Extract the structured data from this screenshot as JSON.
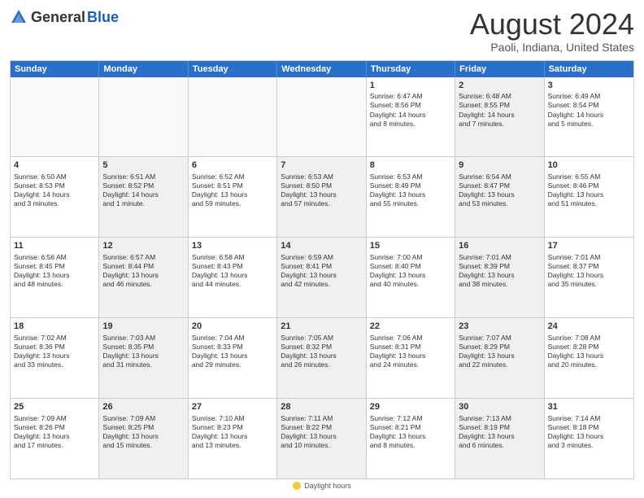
{
  "logo": {
    "general": "General",
    "blue": "Blue"
  },
  "title": "August 2024",
  "location": "Paoli, Indiana, United States",
  "days_of_week": [
    "Sunday",
    "Monday",
    "Tuesday",
    "Wednesday",
    "Thursday",
    "Friday",
    "Saturday"
  ],
  "footer": "Daylight hours",
  "weeks": [
    [
      {
        "day": "",
        "text": "",
        "shaded": false,
        "empty": true
      },
      {
        "day": "",
        "text": "",
        "shaded": false,
        "empty": true
      },
      {
        "day": "",
        "text": "",
        "shaded": false,
        "empty": true
      },
      {
        "day": "",
        "text": "",
        "shaded": false,
        "empty": true
      },
      {
        "day": "1",
        "text": "Sunrise: 6:47 AM\nSunset: 8:56 PM\nDaylight: 14 hours\nand 8 minutes.",
        "shaded": false,
        "empty": false
      },
      {
        "day": "2",
        "text": "Sunrise: 6:48 AM\nSunset: 8:55 PM\nDaylight: 14 hours\nand 7 minutes.",
        "shaded": true,
        "empty": false
      },
      {
        "day": "3",
        "text": "Sunrise: 6:49 AM\nSunset: 8:54 PM\nDaylight: 14 hours\nand 5 minutes.",
        "shaded": false,
        "empty": false
      }
    ],
    [
      {
        "day": "4",
        "text": "Sunrise: 6:50 AM\nSunset: 8:53 PM\nDaylight: 14 hours\nand 3 minutes.",
        "shaded": false,
        "empty": false
      },
      {
        "day": "5",
        "text": "Sunrise: 6:51 AM\nSunset: 8:52 PM\nDaylight: 14 hours\nand 1 minute.",
        "shaded": true,
        "empty": false
      },
      {
        "day": "6",
        "text": "Sunrise: 6:52 AM\nSunset: 8:51 PM\nDaylight: 13 hours\nand 59 minutes.",
        "shaded": false,
        "empty": false
      },
      {
        "day": "7",
        "text": "Sunrise: 6:53 AM\nSunset: 8:50 PM\nDaylight: 13 hours\nand 57 minutes.",
        "shaded": true,
        "empty": false
      },
      {
        "day": "8",
        "text": "Sunrise: 6:53 AM\nSunset: 8:49 PM\nDaylight: 13 hours\nand 55 minutes.",
        "shaded": false,
        "empty": false
      },
      {
        "day": "9",
        "text": "Sunrise: 6:54 AM\nSunset: 8:47 PM\nDaylight: 13 hours\nand 53 minutes.",
        "shaded": true,
        "empty": false
      },
      {
        "day": "10",
        "text": "Sunrise: 6:55 AM\nSunset: 8:46 PM\nDaylight: 13 hours\nand 51 minutes.",
        "shaded": false,
        "empty": false
      }
    ],
    [
      {
        "day": "11",
        "text": "Sunrise: 6:56 AM\nSunset: 8:45 PM\nDaylight: 13 hours\nand 48 minutes.",
        "shaded": false,
        "empty": false
      },
      {
        "day": "12",
        "text": "Sunrise: 6:57 AM\nSunset: 8:44 PM\nDaylight: 13 hours\nand 46 minutes.",
        "shaded": true,
        "empty": false
      },
      {
        "day": "13",
        "text": "Sunrise: 6:58 AM\nSunset: 8:43 PM\nDaylight: 13 hours\nand 44 minutes.",
        "shaded": false,
        "empty": false
      },
      {
        "day": "14",
        "text": "Sunrise: 6:59 AM\nSunset: 8:41 PM\nDaylight: 13 hours\nand 42 minutes.",
        "shaded": true,
        "empty": false
      },
      {
        "day": "15",
        "text": "Sunrise: 7:00 AM\nSunset: 8:40 PM\nDaylight: 13 hours\nand 40 minutes.",
        "shaded": false,
        "empty": false
      },
      {
        "day": "16",
        "text": "Sunrise: 7:01 AM\nSunset: 8:39 PM\nDaylight: 13 hours\nand 38 minutes.",
        "shaded": true,
        "empty": false
      },
      {
        "day": "17",
        "text": "Sunrise: 7:01 AM\nSunset: 8:37 PM\nDaylight: 13 hours\nand 35 minutes.",
        "shaded": false,
        "empty": false
      }
    ],
    [
      {
        "day": "18",
        "text": "Sunrise: 7:02 AM\nSunset: 8:36 PM\nDaylight: 13 hours\nand 33 minutes.",
        "shaded": false,
        "empty": false
      },
      {
        "day": "19",
        "text": "Sunrise: 7:03 AM\nSunset: 8:35 PM\nDaylight: 13 hours\nand 31 minutes.",
        "shaded": true,
        "empty": false
      },
      {
        "day": "20",
        "text": "Sunrise: 7:04 AM\nSunset: 8:33 PM\nDaylight: 13 hours\nand 29 minutes.",
        "shaded": false,
        "empty": false
      },
      {
        "day": "21",
        "text": "Sunrise: 7:05 AM\nSunset: 8:32 PM\nDaylight: 13 hours\nand 26 minutes.",
        "shaded": true,
        "empty": false
      },
      {
        "day": "22",
        "text": "Sunrise: 7:06 AM\nSunset: 8:31 PM\nDaylight: 13 hours\nand 24 minutes.",
        "shaded": false,
        "empty": false
      },
      {
        "day": "23",
        "text": "Sunrise: 7:07 AM\nSunset: 8:29 PM\nDaylight: 13 hours\nand 22 minutes.",
        "shaded": true,
        "empty": false
      },
      {
        "day": "24",
        "text": "Sunrise: 7:08 AM\nSunset: 8:28 PM\nDaylight: 13 hours\nand 20 minutes.",
        "shaded": false,
        "empty": false
      }
    ],
    [
      {
        "day": "25",
        "text": "Sunrise: 7:09 AM\nSunset: 8:26 PM\nDaylight: 13 hours\nand 17 minutes.",
        "shaded": false,
        "empty": false
      },
      {
        "day": "26",
        "text": "Sunrise: 7:09 AM\nSunset: 8:25 PM\nDaylight: 13 hours\nand 15 minutes.",
        "shaded": true,
        "empty": false
      },
      {
        "day": "27",
        "text": "Sunrise: 7:10 AM\nSunset: 8:23 PM\nDaylight: 13 hours\nand 13 minutes.",
        "shaded": false,
        "empty": false
      },
      {
        "day": "28",
        "text": "Sunrise: 7:11 AM\nSunset: 8:22 PM\nDaylight: 13 hours\nand 10 minutes.",
        "shaded": true,
        "empty": false
      },
      {
        "day": "29",
        "text": "Sunrise: 7:12 AM\nSunset: 8:21 PM\nDaylight: 13 hours\nand 8 minutes.",
        "shaded": false,
        "empty": false
      },
      {
        "day": "30",
        "text": "Sunrise: 7:13 AM\nSunset: 8:19 PM\nDaylight: 13 hours\nand 6 minutes.",
        "shaded": true,
        "empty": false
      },
      {
        "day": "31",
        "text": "Sunrise: 7:14 AM\nSunset: 8:18 PM\nDaylight: 13 hours\nand 3 minutes.",
        "shaded": false,
        "empty": false
      }
    ]
  ]
}
